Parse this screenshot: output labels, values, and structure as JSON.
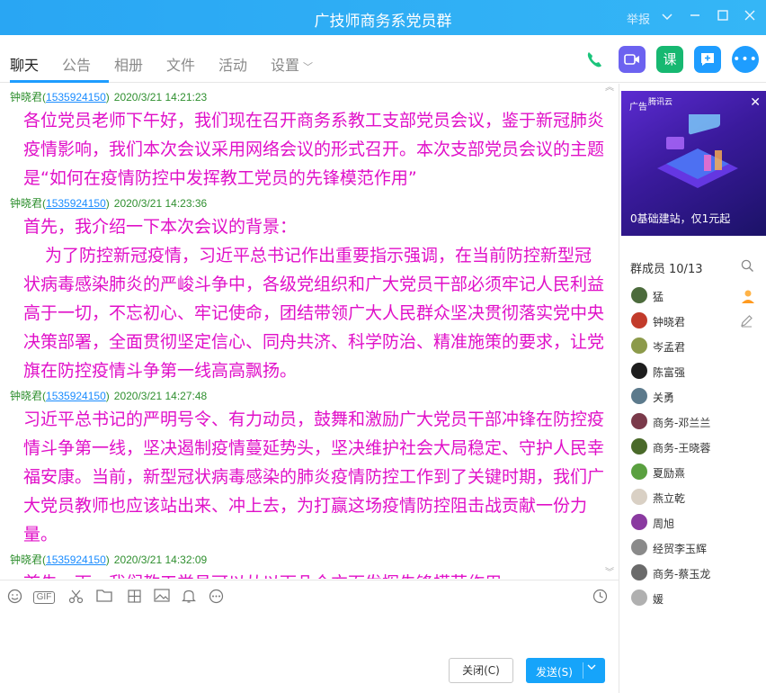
{
  "window": {
    "title": "广技师商务系党员群",
    "report_label": "举报",
    "dropdown_icon": "chevron-down-icon",
    "minimize_icon": "minimize-icon",
    "maximize_icon": "maximize-icon",
    "close_icon": "close-icon"
  },
  "tabs": [
    {
      "label": "聊天",
      "active": true
    },
    {
      "label": "公告"
    },
    {
      "label": "相册"
    },
    {
      "label": "文件"
    },
    {
      "label": "活动"
    },
    {
      "label": "设置"
    }
  ],
  "toolbar_icons": [
    {
      "name": "phone-icon",
      "color": "#1bc47b"
    },
    {
      "name": "video-icon",
      "color": "#6c62f0"
    },
    {
      "name": "course-icon",
      "color": "#17b871",
      "glyph": "课"
    },
    {
      "name": "chat-add-icon",
      "color": "#1e9dff"
    },
    {
      "name": "more-icon",
      "color": "#1e9dff"
    }
  ],
  "messages": [
    {
      "sender": "钟晓君",
      "qq": "1535924150",
      "time": "2020/3/21 14:21:23",
      "lines": [
        "各位党员老师下午好，我们现在召开商务系教工支部党员会议，鉴于新冠肺炎",
        "疫情影响，我们本次会议采用网络会议的形式召开。本次支部党员会议的主题",
        "是“如何在疫情防控中发挥教工党员的先锋模范作用”"
      ]
    },
    {
      "sender": "钟晓君",
      "qq": "1535924150",
      "time": "2020/3/21 14:23:36",
      "lines": [
        "首先，我介绍一下本次会议的背景：",
        "为了防控新冠疫情，习近平总书记作出重要指示强调，在当前防控新型冠",
        "状病毒感染肺炎的严峻斗争中，各级党组织和广大党员干部必须牢记人民利益",
        "高于一切，不忘初心、牢记使命，团结带领广大人民群众坚决贯彻落实党中央",
        "决策部署，全面贯彻坚定信心、同舟共济、科学防治、精准施策的要求，让党",
        "旗在防控疫情斗争第一线高高飘扬。"
      ]
    },
    {
      "sender": "钟晓君",
      "qq": "1535924150",
      "time": "2020/3/21 14:27:48",
      "lines": [
        "习近平总书记的严明号令、有力动员，鼓舞和激励广大党员干部冲锋在防控疫",
        "情斗争第一线，坚决遏制疫情蔓延势头，坚决维护社会大局稳定、守护人民幸",
        "福安康。当前，新型冠状病毒感染的肺炎疫情防控工作到了关键时期，我们广",
        "大党员教师也应该站出来、冲上去，为打赢这场疫情防控阻击战贡献一份力",
        "量。"
      ]
    },
    {
      "sender": "钟晓君",
      "qq": "1535924150",
      "time": "2020/3/21 14:32:09",
      "lines": [
        "首先，下一我们教工党员可以从以下几个方面发挥先锋模范作用"
      ]
    }
  ],
  "input_toolbar_icons": [
    "emoji-icon",
    "gif-icon",
    "scissors-icon",
    "folder-icon",
    "screenshot-icon",
    "image-icon",
    "bell-icon",
    "more-icon",
    "history-icon"
  ],
  "gif_label": "GIF",
  "buttons": {
    "close_label": "关闭(C)",
    "send_label": "发送(S)"
  },
  "ad": {
    "tag": "广告",
    "brand": "腾讯云",
    "caption": "0基础建站，仅1元起"
  },
  "members": {
    "title": "群成员",
    "count": "10/13",
    "list": [
      {
        "name": "猛",
        "avatar_color": "#4c6b3c"
      },
      {
        "name": "钟晓君",
        "avatar_color": "#c23b2b"
      },
      {
        "name": "岑孟君",
        "avatar_color": "#8c9a4a"
      },
      {
        "name": "陈富强",
        "avatar_color": "#1d1d1d"
      },
      {
        "name": "关勇",
        "avatar_color": "#5c7a8c"
      },
      {
        "name": "商务-邓兰兰",
        "avatar_color": "#7a3a4a"
      },
      {
        "name": "商务-王晓蓉",
        "avatar_color": "#4a6a2a"
      },
      {
        "name": "夏励熹",
        "avatar_color": "#5aa040"
      },
      {
        "name": "燕立乾",
        "avatar_color": "#d9d0c4"
      },
      {
        "name": "周旭",
        "avatar_color": "#8a3aa0"
      },
      {
        "name": "经贸李玉辉",
        "avatar_color": "#8a8a8a"
      },
      {
        "name": "商务-蔡玉龙",
        "avatar_color": "#6a6a6a"
      },
      {
        "name": "媛",
        "avatar_color": "#b0b0b0"
      }
    ]
  }
}
